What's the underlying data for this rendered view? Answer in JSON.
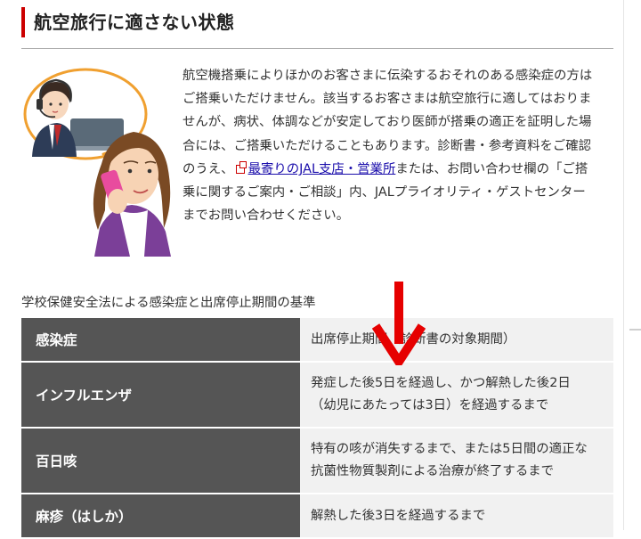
{
  "section": {
    "title": "航空旅行に適さない状態"
  },
  "notice": {
    "lines": [
      "航空機搭乗によりほかのお客さまに伝染するおそれのある感染症の方は",
      "ご搭乗いただけません。該当するお客さまは航空旅行に適してはおりま",
      "せんが、病状、体調などが安定しており医師が搭乗の適正を証明した場",
      "合には、ご搭乗いただけることもあります。診断書・参考資料をご確認"
    ],
    "line5_prefix": "のうえ、",
    "link_label": "最寄りのJAL支店・営業所",
    "line5_suffix": "または、お問い合わせ欄の「ご搭",
    "line6": "乗に関するご案内・ご相談」内、JALプライオリティ・ゲストセンター",
    "line7": "までお問い合わせください。"
  },
  "table": {
    "caption": "学校保健安全法による感染症と出席停止期間の基準",
    "header": {
      "col1": "感染症",
      "col2": "出席停止期間（診断書の対象期間）"
    },
    "rows": [
      {
        "disease": "インフルエンザ",
        "period_line1": "発症した後5日を経過し、かつ解熱した後2日",
        "period_line2": "（幼児にあたっては3日）を経過するまで"
      },
      {
        "disease": "百日咳",
        "period_line1": "特有の咳が消失するまで、または5日間の適正な",
        "period_line2": "抗菌性物質製剤による治療が終了するまで"
      },
      {
        "disease": "麻疹（はしか）",
        "period_line1": "解熱した後3日を経過するまで"
      }
    ]
  },
  "icons": {
    "external_link": "external-link-icon",
    "annotation": "red-down-arrow-icon"
  },
  "colors": {
    "accent": "#cc0000",
    "header_cell": "#555555",
    "value_cell": "#f1f1f1",
    "link": "#1a0dab"
  }
}
